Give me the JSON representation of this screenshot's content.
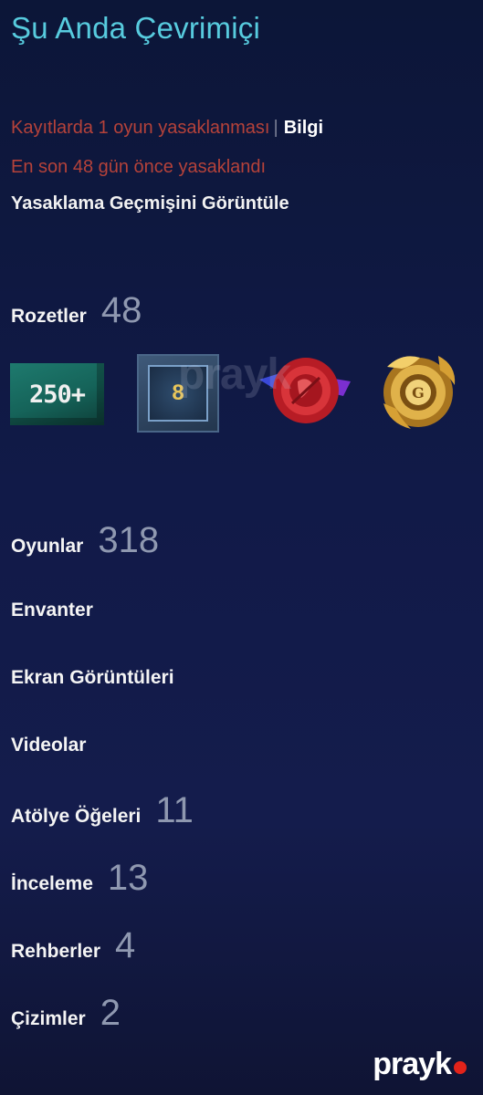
{
  "status": {
    "text": "Şu Anda Çevrimiçi",
    "color": "#57cbde"
  },
  "ban": {
    "line1": "Kayıtlarda 1 oyun yasaklanması",
    "separator": "|",
    "info_link": "Bilgi",
    "line2": "En son 48 gün önce yasaklandı",
    "history_link": "Yasaklama Geçmişini Görüntüle",
    "color": "#b5423a"
  },
  "badges": {
    "label": "Rozetler",
    "count": "48",
    "items": [
      {
        "icon": "badge-250-plus-icon",
        "text": "250+"
      },
      {
        "icon": "badge-years-of-service-icon",
        "text": "8"
      },
      {
        "icon": "badge-wax-seal-icon"
      },
      {
        "icon": "badge-gold-ornament-icon"
      }
    ]
  },
  "links": [
    {
      "label": "Oyunlar",
      "count": "318"
    },
    {
      "label": "Envanter",
      "count": ""
    },
    {
      "label": "Ekran Görüntüleri",
      "count": ""
    },
    {
      "label": "Videolar",
      "count": ""
    },
    {
      "label": "Atölye Öğeleri",
      "count": "11"
    },
    {
      "label": "İnceleme",
      "count": "13"
    },
    {
      "label": "Rehberler",
      "count": "4"
    },
    {
      "label": "Çizimler",
      "count": "2"
    }
  ],
  "watermark": {
    "text": "prayk",
    "accent": "#e2231a"
  }
}
